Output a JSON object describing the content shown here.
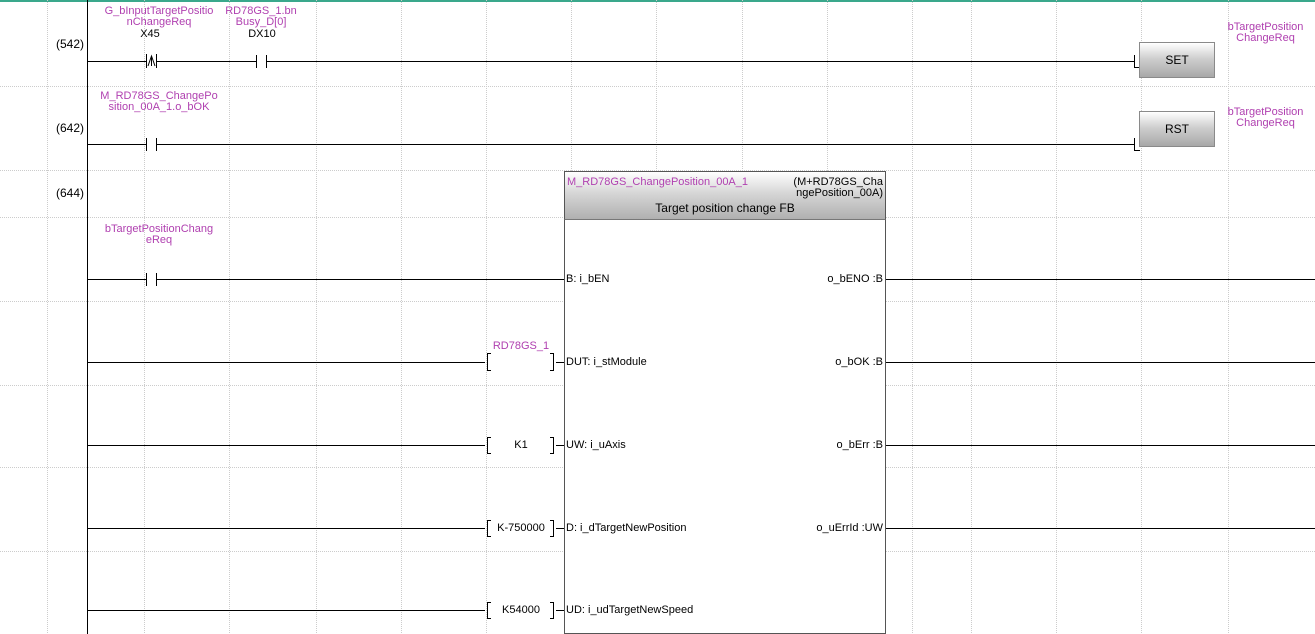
{
  "colors": {
    "device": "#b040b0",
    "grid": "#c8c8c8",
    "line": "#000000",
    "top_bar": "#3aa88c"
  },
  "rungs": [
    {
      "step": "(542)",
      "contacts": [
        {
          "device": "G_bInputTargetPositionChangeReq",
          "device_lines": [
            "G_bInputTargetPositio",
            "nChangeReq"
          ],
          "address": "X45",
          "type": "rising-edge-contact"
        },
        {
          "device": "RD78GS_1.bnBusy_D[0]",
          "device_lines": [
            "RD78GS_1.bn",
            "Busy_D[0]"
          ],
          "address": "DX10",
          "type": "normally-open-contact"
        }
      ],
      "instruction": "SET",
      "target_lines": [
        "bTargetPosition",
        "ChangeReq"
      ]
    },
    {
      "step": "(642)",
      "contacts": [
        {
          "device": "M_RD78GS_ChangePosition_00A_1.o_bOK",
          "device_lines": [
            "M_RD78GS_ChangePo",
            "sition_00A_1.o_bOK"
          ],
          "address": "",
          "type": "normally-open-contact"
        }
      ],
      "instruction": "RST",
      "target_lines": [
        "bTargetPosition",
        "ChangeReq"
      ]
    },
    {
      "step": "(644)"
    }
  ],
  "fb": {
    "instance": "M_RD78GS_ChangePosition_00A_1",
    "type_lines": [
      "(M+RD78GS_Cha",
      "ngePosition_00A)"
    ],
    "description": "Target position change FB",
    "enable_contact": {
      "device_lines": [
        "bTargetPositionChang",
        "eReq"
      ],
      "type": "normally-open-contact"
    },
    "inputs": [
      {
        "pin": "B: i_bEN",
        "operand": ""
      },
      {
        "pin": "DUT: i_stModule",
        "operand": "",
        "operand_label": "RD78GS_1"
      },
      {
        "pin": "UW: i_uAxis",
        "operand": "K1"
      },
      {
        "pin": "D: i_dTargetNewPosition",
        "operand": "K-750000"
      },
      {
        "pin": "UD: i_udTargetNewSpeed",
        "operand": "K54000"
      }
    ],
    "outputs": [
      {
        "pin": "o_bENO :B"
      },
      {
        "pin": "o_bOK :B"
      },
      {
        "pin": "o_bErr :B"
      },
      {
        "pin": "o_uErrId :UW"
      }
    ]
  }
}
